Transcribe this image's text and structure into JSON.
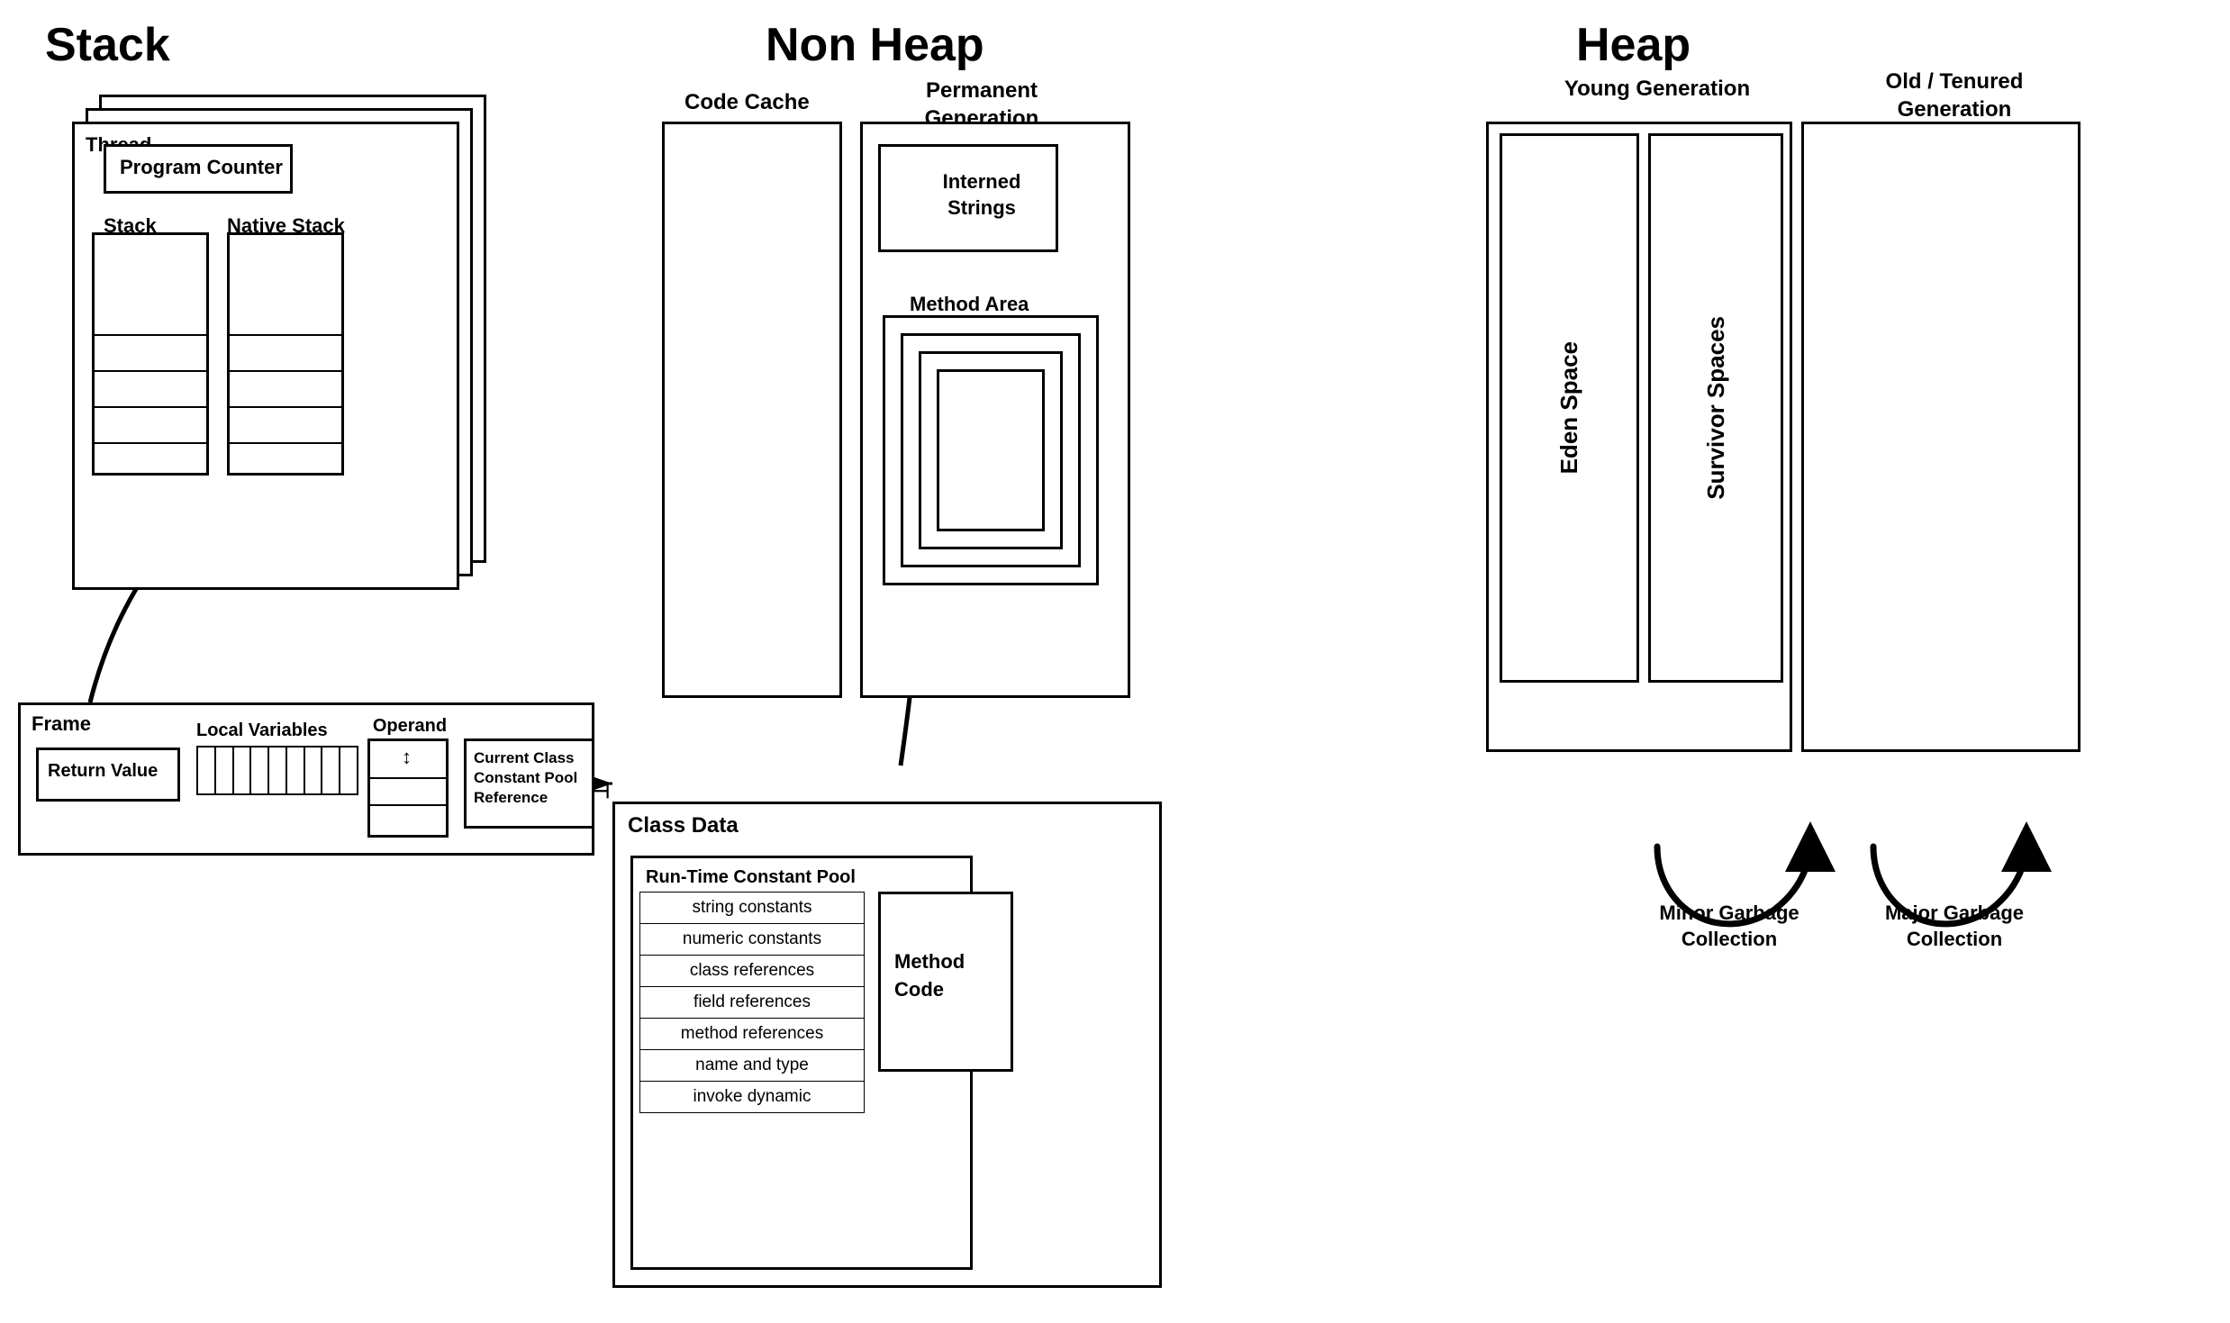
{
  "titles": {
    "stack": "Stack",
    "nonheap": "Non Heap",
    "heap": "Heap"
  },
  "stack": {
    "thread_label": "Thread",
    "program_counter": "Program Counter",
    "stack_label": "Stack",
    "native_stack_label": "Native Stack",
    "frame_label": "Frame",
    "return_value": "Return Value",
    "local_variables": "Local Variables",
    "operand_stack": "Operand Stack",
    "current_class_pool": "Current Class Constant Pool Reference"
  },
  "nonheap": {
    "code_cache": "Code Cache",
    "permanent_gen": "Permanent Generation",
    "interned_strings": "Interned Strings",
    "method_area": "Method Area"
  },
  "class_data": {
    "title": "Class Data",
    "runtime_pool_title": "Run-Time Constant Pool",
    "items": [
      "string constants",
      "numeric constants",
      "class references",
      "field references",
      "method references",
      "name and type",
      "invoke dynamic"
    ],
    "method_code": "Method Code"
  },
  "heap": {
    "young_gen": "Young Generation",
    "old_gen": "Old / Tenured Generation",
    "eden_space": "Eden Space",
    "survivor_spaces": "Survivor Spaces",
    "minor_gc": "Minor Garbage Collection",
    "major_gc": "Major Garbage Collection"
  }
}
